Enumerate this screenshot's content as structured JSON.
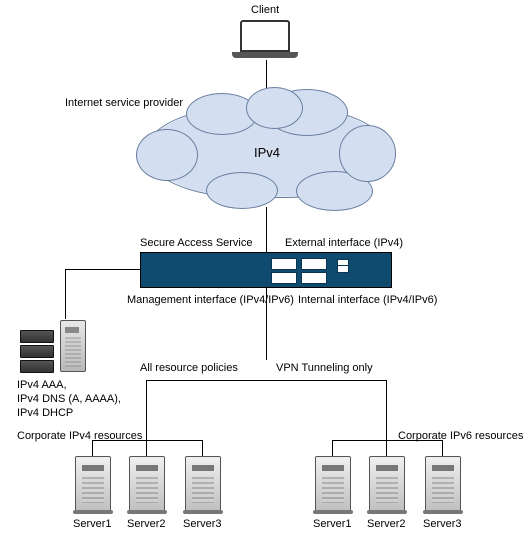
{
  "client": {
    "label": "Client"
  },
  "isp": {
    "label": "Internet service provider"
  },
  "cloud": {
    "label": "IPv4"
  },
  "appliance": {
    "title": "Secure Access Service",
    "external_if": "External interface (IPv4)",
    "mgmt_if": "Management interface (IPv4/IPv6)",
    "internal_if": "Internal interface (IPv4/IPv6)"
  },
  "mgmt_services": "IPv4 AAA,\nIPv4 DNS (A, AAAA),\nIPv4 DHCP",
  "branches": {
    "left": "All resource policies",
    "right": "VPN Tunneling only"
  },
  "corp_ipv4_title": "Corporate IPv4 resources",
  "corp_ipv6_title": "Corporate IPv6 resources",
  "servers_left": {
    "s1": "Server1",
    "s2": "Server2",
    "s3": "Server3"
  },
  "servers_right": {
    "s1": "Server1",
    "s2": "Server2",
    "s3": "Server3"
  }
}
